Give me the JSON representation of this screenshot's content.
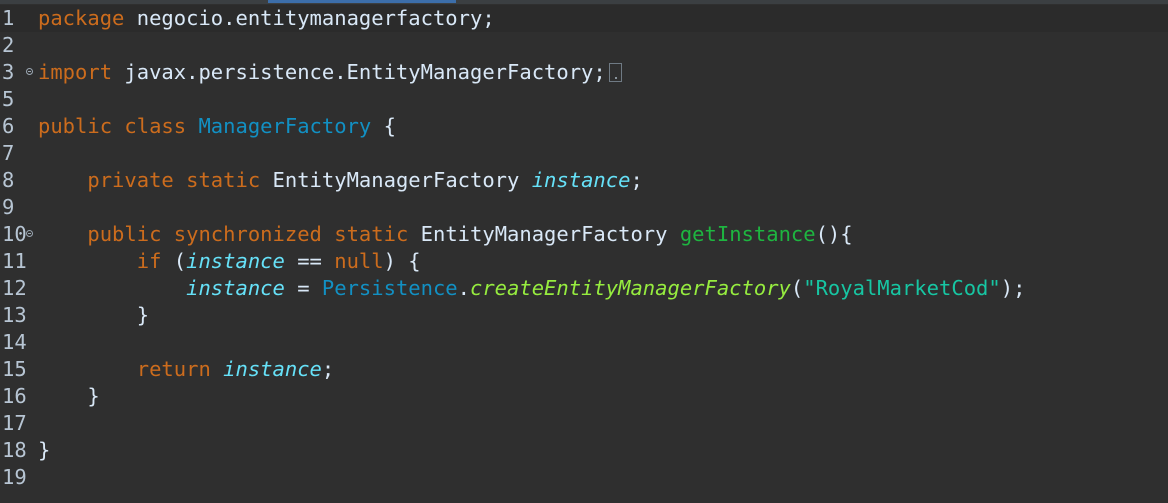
{
  "editor": {
    "lines": [
      {
        "num": "1",
        "tokens": [
          [
            "kw",
            "package"
          ],
          [
            "plain",
            " negocio.entitymanagerfactory;"
          ]
        ]
      },
      {
        "num": "2",
        "tokens": []
      },
      {
        "num": "3",
        "fold": true,
        "collapsed": true,
        "tokens": [
          [
            "kw",
            "import"
          ],
          [
            "plain",
            " javax.persistence.EntityManagerFactory;"
          ]
        ]
      },
      {
        "num": "5",
        "tokens": []
      },
      {
        "num": "6",
        "tokens": [
          [
            "kw",
            "public"
          ],
          [
            "plain",
            " "
          ],
          [
            "kw",
            "class"
          ],
          [
            "plain",
            " "
          ],
          [
            "type",
            "ManagerFactory"
          ],
          [
            "plain",
            " {"
          ]
        ]
      },
      {
        "num": "7",
        "tokens": []
      },
      {
        "num": "8",
        "tokens": [
          [
            "plain",
            "    "
          ],
          [
            "kw",
            "private"
          ],
          [
            "plain",
            " "
          ],
          [
            "kw",
            "static"
          ],
          [
            "plain",
            " EntityManagerFactory "
          ],
          [
            "field",
            "instance"
          ],
          [
            "plain",
            ";"
          ]
        ]
      },
      {
        "num": "9",
        "tokens": []
      },
      {
        "num": "10",
        "fold": true,
        "tokens": [
          [
            "plain",
            "    "
          ],
          [
            "kw",
            "public"
          ],
          [
            "plain",
            " "
          ],
          [
            "kw",
            "synchronized"
          ],
          [
            "plain",
            " "
          ],
          [
            "kw",
            "static"
          ],
          [
            "plain",
            " EntityManagerFactory "
          ],
          [
            "method",
            "getInstance"
          ],
          [
            "plain",
            "(){"
          ]
        ]
      },
      {
        "num": "11",
        "tokens": [
          [
            "plain",
            "        "
          ],
          [
            "kw",
            "if"
          ],
          [
            "plain",
            " ("
          ],
          [
            "field",
            "instance"
          ],
          [
            "plain",
            " == "
          ],
          [
            "kw",
            "null"
          ],
          [
            "plain",
            ") {"
          ]
        ]
      },
      {
        "num": "12",
        "tokens": [
          [
            "plain",
            "            "
          ],
          [
            "field",
            "instance"
          ],
          [
            "plain",
            " = "
          ],
          [
            "type",
            "Persistence"
          ],
          [
            "plain",
            "."
          ],
          [
            "smethod",
            "createEntityManagerFactory"
          ],
          [
            "plain",
            "("
          ],
          [
            "str",
            "\"RoyalMarketCod\""
          ],
          [
            "plain",
            ");"
          ]
        ]
      },
      {
        "num": "13",
        "tokens": [
          [
            "plain",
            "        }"
          ]
        ]
      },
      {
        "num": "14",
        "tokens": []
      },
      {
        "num": "15",
        "tokens": [
          [
            "plain",
            "        "
          ],
          [
            "kw",
            "return"
          ],
          [
            "plain",
            " "
          ],
          [
            "field",
            "instance"
          ],
          [
            "plain",
            ";"
          ]
        ]
      },
      {
        "num": "16",
        "tokens": [
          [
            "plain",
            "    }"
          ]
        ]
      },
      {
        "num": "17",
        "tokens": []
      },
      {
        "num": "18",
        "tokens": [
          [
            "plain",
            "}"
          ]
        ]
      },
      {
        "num": "19",
        "tokens": []
      }
    ]
  },
  "colors": {
    "background": "#2f2f2f",
    "keyword": "#cc6c1d",
    "type": "#1290c3",
    "field": "#66e1f8",
    "method": "#1eb540",
    "static_method": "#96ec3f",
    "string": "#17c6a3",
    "plain": "#d9e8f7",
    "line_number": "#b7c5d3"
  }
}
